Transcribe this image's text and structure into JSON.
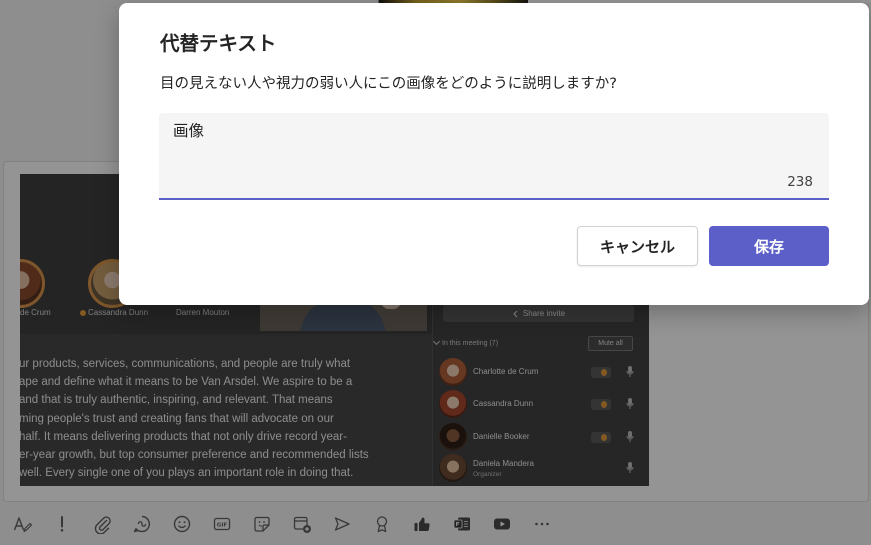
{
  "dialog": {
    "title": "代替テキスト",
    "description": "目の見えない人や視力の弱い人にこの画像をどのように説明しますか?",
    "alt_text_value": "画像",
    "char_count": "238",
    "cancel_label": "キャンセル",
    "save_label": "保存"
  },
  "compose_image": {
    "video_tiles": [
      "de Crum",
      "Cassandra Dunn",
      "Darren Mouton"
    ],
    "paragraph_lines": [
      "ur products, services, communications, and people are truly what",
      "ape and define what it means to be Van Arsdel. We aspire to be a",
      "and that is truly authentic, inspiring, and relevant. That means",
      "ming people's trust and creating fans that will advocate on our",
      "half. It means delivering products that not only drive record year-",
      "er-year growth, but top consumer preference and recommended lists",
      "well. Every single one of you plays an important role in doing that."
    ],
    "share_invite_label": "Share invite",
    "meeting_list_header": "In this meeting (7)",
    "mute_all_label": "Mute all",
    "participants": [
      {
        "name": "Charlotte de Crum"
      },
      {
        "name": "Cassandra Dunn"
      },
      {
        "name": "Danielle Booker"
      },
      {
        "name": "Daniela Mandera",
        "role": "Organizer"
      }
    ]
  },
  "toolbar": {
    "icons": [
      "format-icon",
      "important-icon",
      "attach-icon",
      "loop-icon",
      "emoji-icon",
      "gif-icon",
      "sticker-icon",
      "schedule-meeting-icon",
      "stream-icon",
      "praise-icon",
      "hand-icon",
      "forms-icon",
      "youtube-icon",
      "more-options-icon"
    ],
    "gif_label": "GIF"
  },
  "colors": {
    "accent": "#5b5fc7",
    "backdrop": "rgba(0,0,0,0.42)"
  }
}
